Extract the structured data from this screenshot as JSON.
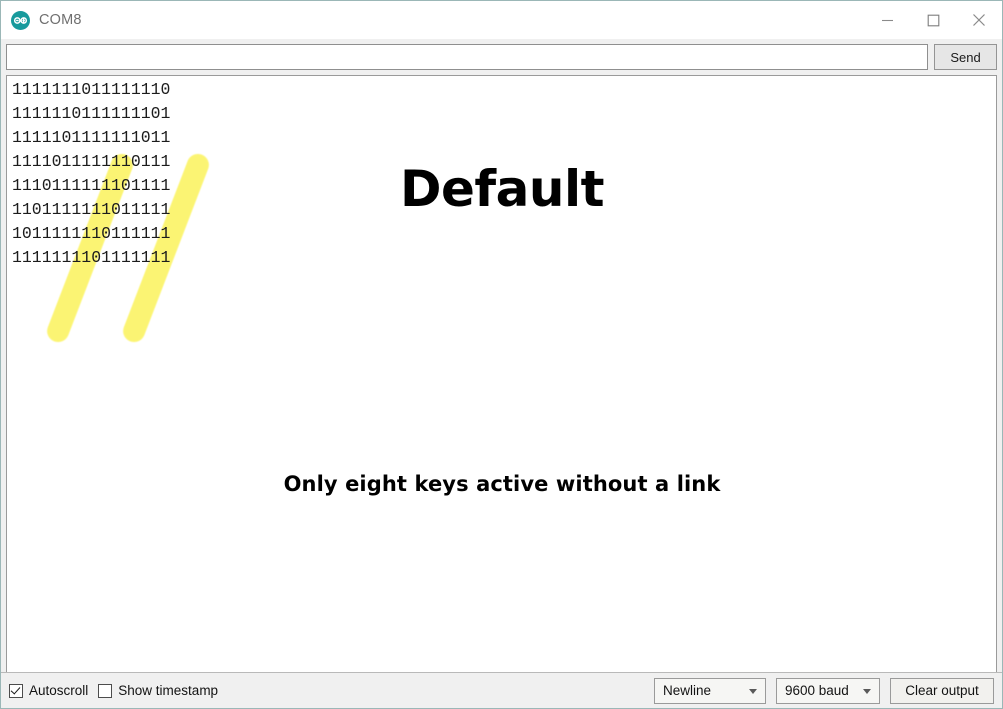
{
  "window": {
    "app_icon": "arduino-logo-icon",
    "title": "COM8",
    "controls": {
      "minimize": "minimize-icon",
      "maximize": "maximize-icon",
      "close": "close-icon"
    }
  },
  "send_row": {
    "input_value": "",
    "input_placeholder": "",
    "send_label": "Send"
  },
  "console": {
    "lines": [
      "1111111011111110",
      "1111110111111101",
      "1111101111111011",
      "1111011111110111",
      "1110111111101111",
      "1101111111011111",
      "1011111110111111",
      "1111111101111111"
    ],
    "overlay_title": "Default",
    "overlay_note": "Only eight keys active without a link",
    "highlight_color": "#fbf24c",
    "highlight_count": 2
  },
  "status_bar": {
    "autoscroll_label": "Autoscroll",
    "autoscroll_checked": true,
    "timestamp_label": "Show timestamp",
    "timestamp_checked": false,
    "line_ending": "Newline",
    "baud_rate": "9600 baud",
    "clear_label": "Clear output"
  }
}
